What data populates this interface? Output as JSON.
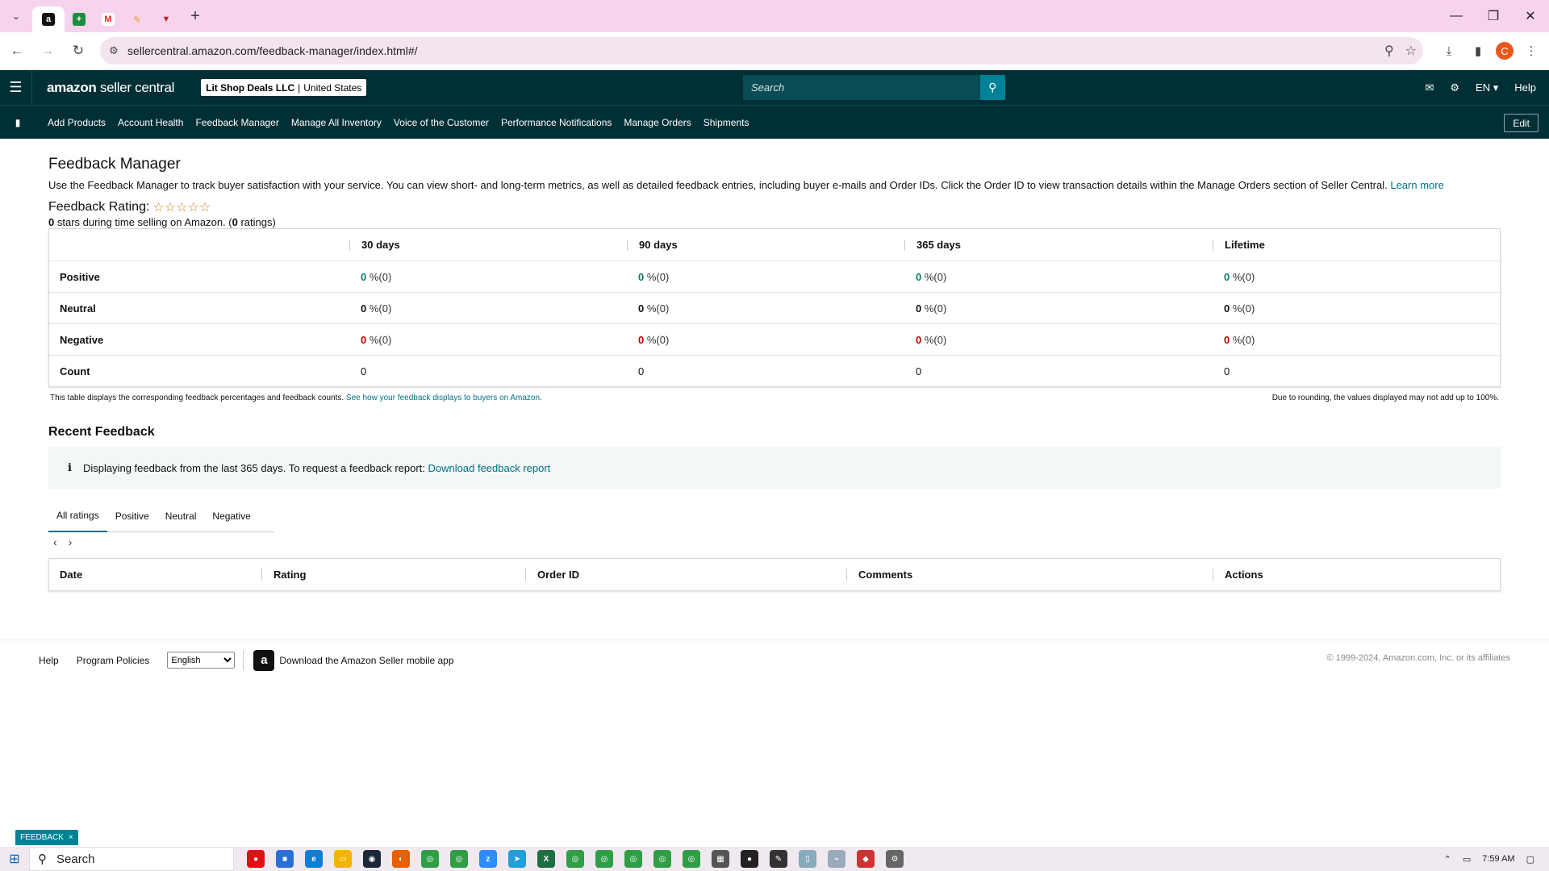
{
  "browser": {
    "url": "sellercentral.amazon.com/feedback-manager/index.html#/",
    "tabs": [
      {
        "icon": "amazon-icon",
        "glyph": "a",
        "color": "#111111",
        "active": true
      },
      {
        "icon": "sheets-icon",
        "glyph": "+",
        "color": "#1e8e3e",
        "active": false
      },
      {
        "icon": "gmail-icon",
        "glyph": "M",
        "color": "#d93025",
        "active": false
      },
      {
        "icon": "pencil-icon",
        "glyph": "✎",
        "color": "#f29900",
        "active": false
      },
      {
        "icon": "shield-icon",
        "glyph": "▼",
        "color": "#c5221f",
        "active": false
      }
    ],
    "profile_initial": "C"
  },
  "header": {
    "logo_brand": "amazon",
    "logo_rest": " seller central",
    "store_name": "Lit Shop Deals LLC",
    "store_region": "United States",
    "search_placeholder": "Search",
    "language": "EN ▾",
    "help": "Help"
  },
  "nav": {
    "items": [
      "Add Products",
      "Account Health",
      "Feedback Manager",
      "Manage All Inventory",
      "Voice of the Customer",
      "Performance Notifications",
      "Manage Orders",
      "Shipments"
    ],
    "edit": "Edit"
  },
  "page": {
    "title": "Feedback Manager",
    "intro": "Use the Feedback Manager to track buyer satisfaction with your service. You can view short- and long-term metrics, as well as detailed feedback entries, including buyer e-mails and Order IDs. Click the Order ID to view transaction details within the Manage Orders section of Seller Central.",
    "learn_more": "Learn more",
    "rating_label": "Feedback Rating:",
    "stars": "☆☆☆☆☆",
    "rating_value": "0",
    "rating_mid": " stars during time selling on Amazon. (",
    "rating_count": "0",
    "rating_end": " ratings)"
  },
  "feedback_table": {
    "columns": [
      "30 days",
      "90 days",
      "365 days",
      "Lifetime"
    ],
    "rows": [
      {
        "label": "Positive",
        "cells": [
          {
            "value": "0",
            "pct": " %(0)"
          },
          {
            "value": "0",
            "pct": " %(0)"
          },
          {
            "value": "0",
            "pct": " %(0)"
          },
          {
            "value": "0",
            "pct": " %(0)"
          }
        ]
      },
      {
        "label": "Neutral",
        "cells": [
          {
            "value": "0",
            "pct": " %(0)"
          },
          {
            "value": "0",
            "pct": " %(0)"
          },
          {
            "value": "0",
            "pct": " %(0)"
          },
          {
            "value": "0",
            "pct": " %(0)"
          }
        ]
      },
      {
        "label": "Negative",
        "cells": [
          {
            "value": "0",
            "pct": " %(0)"
          },
          {
            "value": "0",
            "pct": " %(0)"
          },
          {
            "value": "0",
            "pct": " %(0)"
          },
          {
            "value": "0",
            "pct": " %(0)"
          }
        ]
      },
      {
        "label": "Count",
        "cells": [
          "0",
          "0",
          "0",
          "0"
        ]
      }
    ],
    "note_left": "This table displays the corresponding feedback percentages and feedback counts.",
    "note_link": "See how your feedback displays to buyers on Amazon.",
    "note_right": "Due to rounding, the values displayed may not add up to 100%."
  },
  "recent": {
    "title": "Recent Feedback",
    "info_text": "Displaying feedback from the last 365 days. To request a feedback report:",
    "info_link": "Download feedback report",
    "tabs": [
      "All ratings",
      "Positive",
      "Neutral",
      "Negative"
    ],
    "active_tab": "All ratings",
    "columns": [
      "Date",
      "Rating",
      "Order ID",
      "Comments",
      "Actions"
    ]
  },
  "footer": {
    "help": "Help",
    "policies": "Program Policies",
    "language": "English",
    "app_text": "Download the Amazon Seller mobile app",
    "copyright": "© 1999-2024, Amazon.com, Inc. or its affiliates"
  },
  "feedback_tab": "FEEDBACK",
  "taskbar": {
    "search": "Search",
    "time": "7:59 AM"
  },
  "colors": {
    "header_bg": "#002f36",
    "accent": "#008296",
    "link": "#007185",
    "positive": "#067d62",
    "negative": "#c40000"
  }
}
